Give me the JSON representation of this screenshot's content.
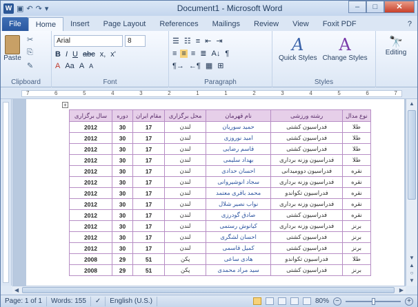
{
  "window": {
    "title": "Document1 - Microsoft Word",
    "logo": "W",
    "min": "–",
    "max": "□",
    "close": "✕"
  },
  "qat": {
    "save": "▣",
    "undo": "↶",
    "redo": "↷",
    "more": "▾"
  },
  "tabs": [
    "File",
    "Home",
    "Insert",
    "Page Layout",
    "References",
    "Mailings",
    "Review",
    "View",
    "Foxit PDF"
  ],
  "active_tab": "Home",
  "ribbon": {
    "clipboard": {
      "label": "Clipboard",
      "paste": "Paste",
      "cut": "✂",
      "copy": "⎘",
      "format": "✎"
    },
    "font": {
      "label": "Font",
      "name": "Arial",
      "size": "8",
      "bold": "B",
      "italic": "I",
      "underline": "U",
      "strike": "abc",
      "sub": "x,",
      "sup": "x'",
      "clear": "Aa",
      "grow": "A",
      "shrink": "A"
    },
    "paragraph": {
      "label": "Paragraph",
      "sort": "A↓",
      "pilcrow": "¶"
    },
    "styles": {
      "label": "Styles",
      "quick": "Quick Styles",
      "change": "Change Styles",
      "sample": "A"
    },
    "editing": {
      "label": "Editing",
      "icon": "🔭"
    }
  },
  "table": {
    "headers": [
      "سال برگزاری",
      "دوره",
      "مقام ایران",
      "محل برگزاری",
      "نام قهرمان",
      "رشته ورزشی",
      "نوع مدال"
    ],
    "rows": [
      [
        "2012",
        "30",
        "17",
        "لندن",
        "حمید سوریان",
        "فدراسیون کشتی",
        "طلا"
      ],
      [
        "2012",
        "30",
        "17",
        "لندن",
        "امید نوروزی",
        "فدراسیون کشتی",
        "طلا"
      ],
      [
        "2012",
        "30",
        "17",
        "لندن",
        "قاسم رضایی",
        "فدراسیون کشتی",
        "طلا"
      ],
      [
        "2012",
        "30",
        "17",
        "لندن",
        "بهداد سلیمی",
        "فدراسیون وزنه برداری",
        "طلا"
      ],
      [
        "2012",
        "30",
        "17",
        "لندن",
        "احسان حدادی",
        "فدراسیون دوومیدانی",
        "نقره"
      ],
      [
        "2012",
        "30",
        "17",
        "لندن",
        "سجاد انوشیروانی",
        "فدراسیون وزنه برداری",
        "نقره"
      ],
      [
        "2012",
        "30",
        "17",
        "لندن",
        "محمد باقری معتمد",
        "فدراسیون تکواندو",
        "نقره"
      ],
      [
        "2012",
        "30",
        "17",
        "لندن",
        "نواب نصیر شلال",
        "فدراسیون وزنه برداری",
        "نقره"
      ],
      [
        "2012",
        "30",
        "17",
        "لندن",
        "صادق گودرزی",
        "فدراسیون کشتی",
        "نقره"
      ],
      [
        "2012",
        "30",
        "17",
        "لندن",
        "کیانوش رستمی",
        "فدراسیون وزنه برداری",
        "برنز"
      ],
      [
        "2012",
        "30",
        "17",
        "لندن",
        "احسان لشگری",
        "فدراسیون کشتی",
        "برنز"
      ],
      [
        "2012",
        "30",
        "17",
        "لندن",
        "کمیل قاسمی",
        "فدراسیون کشتی",
        "برنز"
      ],
      [
        "2008",
        "29",
        "51",
        "پکن",
        "هادی ساعی",
        "فدراسیون تکواندو",
        "طلا"
      ],
      [
        "2008",
        "29",
        "51",
        "پکن",
        "سید مراد محمدی",
        "فدراسیون کشتی",
        "برنز"
      ]
    ]
  },
  "status": {
    "page": "Page: 1 of 1",
    "words": "Words: 155",
    "lang": "English (U.S.)",
    "zoom": "80%",
    "minus": "−",
    "plus": "+"
  }
}
